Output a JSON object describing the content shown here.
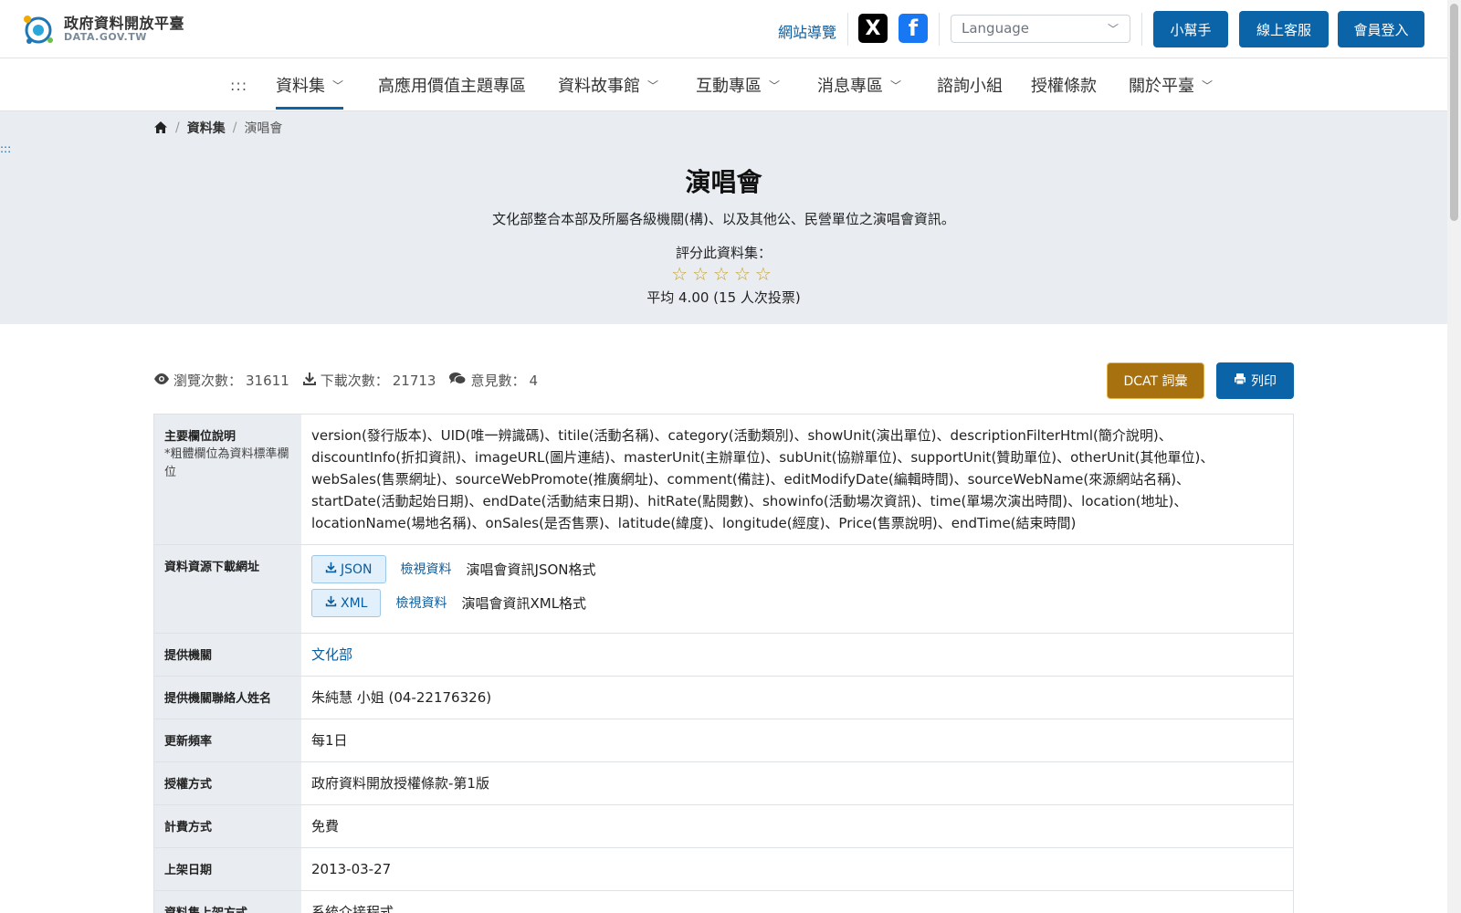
{
  "header": {
    "logo_title": "政府資料開放平臺",
    "logo_sub": "DATA.GOV.TW",
    "sitemap": "網站導覽",
    "social_x": "X",
    "social_fb": "f",
    "language_placeholder": "Language",
    "btn_helper": "小幫手",
    "btn_service": "線上客服",
    "btn_login": "會員登入"
  },
  "nav": {
    "dots": ":::",
    "items": [
      {
        "label": "資料集"
      },
      {
        "label": "高應用價值主題專區"
      },
      {
        "label": "資料故事館"
      },
      {
        "label": "互動專區"
      },
      {
        "label": "消息專區"
      },
      {
        "label": "諮詢小組"
      },
      {
        "label": "授權條款"
      },
      {
        "label": "關於平臺"
      }
    ]
  },
  "breadcrumb": {
    "level1": "資料集",
    "level2": "演唱會"
  },
  "hero": {
    "dots": ":::",
    "title": "演唱會",
    "description": "文化部整合本部及所屬各級機關(構)、以及其他公、民營單位之演唱會資訊。",
    "rate_label": "評分此資料集：",
    "stars": "☆☆☆☆☆",
    "average": "平均 4.00 (15 人次投票)"
  },
  "stats": {
    "views_label": "瀏覽次數：",
    "views": "31611",
    "downloads_label": "下載次數：",
    "downloads": "21713",
    "comments_label": "意見數：",
    "comments": "4",
    "btn_dcat": "DCAT 詞彙",
    "btn_print": "列印"
  },
  "table": {
    "fields_label": "主要欄位說明",
    "fields_note": "*粗體欄位為資料標準欄位",
    "fields_value": "version(發行版本)、UID(唯一辨識碼)、titile(活動名稱)、category(活動類別)、showUnit(演出單位)、descriptionFilterHtml(簡介說明)、discountInfo(折扣資訊)、imageURL(圖片連結)、masterUnit(主辦單位)、subUnit(協辦單位)、supportUnit(贊助單位)、otherUnit(其他單位)、webSales(售票網址)、sourceWebPromote(推廣網址)、comment(備註)、editModifyDate(編輯時間)、sourceWebName(來源網站名稱)、startDate(活動起始日期)、endDate(活動結束日期)、hitRate(點閱數)、showinfo(活動場次資訊)、time(單場次演出時間)、location(地址)、locationName(場地名稱)、onSales(是否售票)、latitude(緯度)、longitude(經度)、Price(售票說明)、endTime(結束時間)",
    "resource_label": "資料資源下載網址",
    "resources": [
      {
        "format": "JSON",
        "view": "檢視資料",
        "desc": "演唱會資訊JSON格式"
      },
      {
        "format": "XML",
        "view": "檢視資料",
        "desc": "演唱會資訊XML格式"
      }
    ],
    "agency_label": "提供機關",
    "agency": "文化部",
    "contact_label": "提供機關聯絡人姓名",
    "contact": "朱純慧 小姐 (04-22176326)",
    "frequency_label": "更新頻率",
    "frequency": "每1日",
    "license_label": "授權方式",
    "license": "政府資料開放授權條款-第1版",
    "fee_label": "計費方式",
    "fee": "免費",
    "date_label": "上架日期",
    "date": "2013-03-27",
    "method_label": "資料集上架方式",
    "method": "系統介接程式"
  },
  "colors": {
    "primary": "#0b64a8",
    "dcat": "#a8710f",
    "hero_bg": "#e9edf1",
    "star": "#c9a227"
  }
}
